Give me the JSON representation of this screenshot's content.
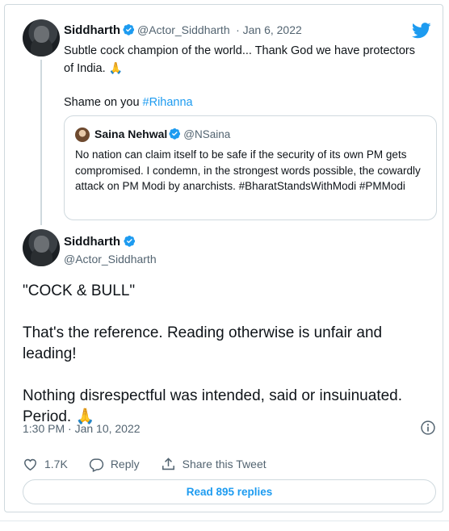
{
  "tweet1": {
    "name": "Siddharth",
    "handle": "@Actor_Siddharth",
    "date": "· Jan 6, 2022",
    "text_line1": "Subtle cock champion of the world... Thank God we have protectors",
    "text_line2": "of India.",
    "emoji": "🙏",
    "text_shame": "Shame on you ",
    "hashtag": "#Rihanna"
  },
  "quoted": {
    "name": "Saina Nehwal",
    "handle": "@NSaina",
    "text": "No nation can claim itself to be safe if the security of its own PM gets compromised. I condemn, in the strongest words possible, the cowardly attack on PM Modi by anarchists. #BharatStandsWithModi #PMModi"
  },
  "tweet2": {
    "name": "Siddharth",
    "handle": "@Actor_Siddharth",
    "para1": "\"COCK & BULL\"",
    "para2": "That's the reference. Reading otherwise is unfair and leading!",
    "para3": "Nothing disrespectful was intended, said or insuinuated. Period.",
    "emoji": "🙏",
    "timestamp": "1:30 PM · Jan 10, 2022"
  },
  "actions": {
    "likes": "1.7K",
    "reply_label": "Reply",
    "share_label": "Share this Tweet"
  },
  "read_replies": "Read 895 replies",
  "colors": {
    "twitter_blue": "#1d9bf0",
    "text": "#0f1419",
    "secondary": "#536471",
    "border": "#cfd9de"
  },
  "icons": [
    "verified-badge-icon",
    "twitter-bird-icon",
    "info-icon",
    "heart-icon",
    "reply-icon",
    "share-icon"
  ]
}
